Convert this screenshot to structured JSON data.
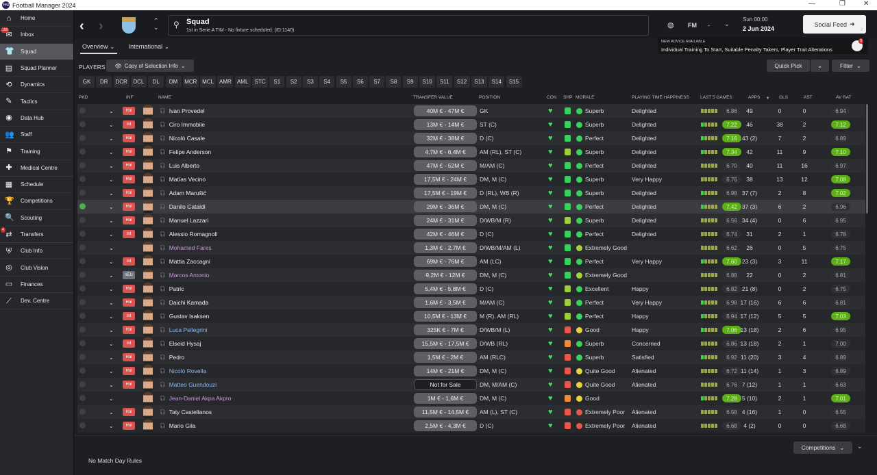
{
  "window": {
    "title": "Football Manager 2024",
    "logo": "24"
  },
  "sidebar": {
    "items": [
      {
        "label": "Home",
        "icon": "⌂"
      },
      {
        "label": "Inbox",
        "icon": "✉",
        "badge": "150"
      },
      {
        "label": "Squad",
        "icon": "👕",
        "active": true
      },
      {
        "label": "Squad Planner",
        "icon": "▤"
      },
      {
        "label": "Dynamics",
        "icon": "⟲"
      },
      {
        "label": "Tactics",
        "icon": "✎"
      },
      {
        "label": "Data Hub",
        "icon": "◉"
      },
      {
        "label": "Staff",
        "icon": "👥"
      },
      {
        "label": "Training",
        "icon": "⚑"
      },
      {
        "label": "Medical Centre",
        "icon": "✚"
      },
      {
        "label": "Schedule",
        "icon": "▦"
      },
      {
        "label": "Competitions",
        "icon": "🏆"
      },
      {
        "label": "Scouting",
        "icon": "🔍"
      },
      {
        "label": "Transfers",
        "icon": "⇄",
        "badge": "4"
      },
      {
        "label": "Club Info",
        "icon": "⛨"
      },
      {
        "label": "Club Vision",
        "icon": "◎"
      },
      {
        "label": "Finances",
        "icon": "▭"
      },
      {
        "label": "Dev. Centre",
        "icon": "⟋"
      }
    ]
  },
  "header": {
    "title": "Squad",
    "subtitle": "1st in Serie A TIM - No fixture scheduled. (ID:1140)",
    "fm": "FM",
    "dash": "-",
    "time": "Sun 00:00",
    "date": "2 Jun 2024",
    "social": "Social Feed",
    "social_count": "2",
    "advice_title": "NEW ADVICE AVAILABLE",
    "advice": "Individual Training To Start, Suitable Penalty Takers, Player Trait Alterations",
    "advice_badge": "3"
  },
  "tabs": [
    {
      "label": "Overview ⌄"
    },
    {
      "label": "International ⌄"
    }
  ],
  "players_label": "PLAYERS",
  "view_select": "Copy of Selection Info",
  "quick_pick": "Quick Pick",
  "filter": "Filter",
  "positions": [
    "GK",
    "DR",
    "DCR",
    "DCL",
    "DL",
    "DM",
    "MCR",
    "MCL",
    "AMR",
    "AML",
    "STC",
    "S1",
    "S2",
    "S3",
    "S4",
    "S5",
    "S6",
    "S7",
    "S8",
    "S9",
    "S10",
    "S11",
    "S12",
    "S13",
    "S14",
    "S15"
  ],
  "columns": {
    "pkd": "PKD",
    "inf": "INF",
    "name": "NAME",
    "tv": "TRANSFER VALUE",
    "pos": "POSITION",
    "con": "CON",
    "shp": "SHP",
    "morale": "MORALE",
    "pth": "PLAYING TIME HAPPINESS",
    "l5": "LAST 5 GAMES",
    "apps": "APPS",
    "gls": "GLS",
    "ast": "AST",
    "avr": "AV RAT"
  },
  "colors": {
    "accent_green": "#5cae1a",
    "badge_red": "#d9534f"
  },
  "players": [
    {
      "pkd": false,
      "inf": "Hol",
      "name": "Ivan Provedel",
      "nc": "",
      "tv": "40M € - 47M €",
      "pos": "GK",
      "shp": "good",
      "mor": "Superb",
      "pth": "Delighted",
      "l5": "6.86",
      "apps": "49",
      "gls": "0",
      "ast": "0",
      "avr": "6.94"
    },
    {
      "pkd": false,
      "inf": "Int",
      "name": "Ciro Immobile",
      "nc": "",
      "tv": "13M € - 14M €",
      "pos": "ST (C)",
      "shp": "good",
      "mor": "Superb",
      "pth": "Delighted",
      "l5": "7.22",
      "apps": "46",
      "gls": "38",
      "ast": "2",
      "avr": "7.12"
    },
    {
      "pkd": false,
      "inf": "Hol",
      "name": "Nicolò Casale",
      "nc": "",
      "tv": "32M € - 38M €",
      "pos": "D (C)",
      "shp": "good",
      "mor": "Perfect",
      "pth": "Delighted",
      "l5": "7.16",
      "apps": "43 (2)",
      "gls": "7",
      "ast": "2",
      "avr": "6.89"
    },
    {
      "pkd": false,
      "inf": "Hol",
      "name": "Felipe Anderson",
      "nc": "",
      "tv": "4,7M € - 6,4M €",
      "pos": "AM (RL), ST (C)",
      "shp": "ok",
      "mor": "Superb",
      "pth": "Delighted",
      "l5": "7.34",
      "apps": "42",
      "gls": "11",
      "ast": "9",
      "avr": "7.10"
    },
    {
      "pkd": false,
      "inf": "Hol",
      "name": "Luis Alberto",
      "nc": "",
      "tv": "47M € - 52M €",
      "pos": "M/AM (C)",
      "shp": "good",
      "mor": "Perfect",
      "pth": "Delighted",
      "l5": "6.70",
      "apps": "40",
      "gls": "11",
      "ast": "16",
      "avr": "6.97"
    },
    {
      "pkd": false,
      "inf": "Hol",
      "name": "Matías Vecino",
      "nc": "",
      "tv": "17,5M € - 24M €",
      "pos": "DM, M (C)",
      "shp": "good",
      "mor": "Superb",
      "pth": "Very Happy",
      "l5": "6.76",
      "apps": "38",
      "gls": "13",
      "ast": "12",
      "avr": "7.08"
    },
    {
      "pkd": false,
      "inf": "Hol",
      "name": "Adam Marušić",
      "nc": "",
      "tv": "17,5M € - 19M €",
      "pos": "D (RL), WB (R)",
      "shp": "good",
      "mor": "Superb",
      "pth": "Delighted",
      "l5": "6.98",
      "apps": "37 (7)",
      "gls": "2",
      "ast": "8",
      "avr": "7.02"
    },
    {
      "pkd": true,
      "inf": "Hol",
      "name": "Danilo Cataldi",
      "nc": "",
      "tv": "29M € - 36M €",
      "pos": "DM, M (C)",
      "shp": "good",
      "mor": "Perfect",
      "pth": "Delighted",
      "l5": "7.42",
      "apps": "37 (3)",
      "gls": "6",
      "ast": "2",
      "avr": "6.96"
    },
    {
      "pkd": false,
      "inf": "Hol",
      "name": "Manuel Lazzari",
      "nc": "",
      "tv": "24M € - 31M €",
      "pos": "D/WB/M (R)",
      "shp": "ok",
      "mor": "Superb",
      "pth": "Delighted",
      "l5": "6.56",
      "apps": "34 (4)",
      "gls": "0",
      "ast": "6",
      "avr": "6.95"
    },
    {
      "pkd": false,
      "inf": "Int",
      "name": "Alessio Romagnoli",
      "nc": "",
      "tv": "42M € - 46M €",
      "pos": "D (C)",
      "shp": "good",
      "mor": "Perfect",
      "pth": "Delighted",
      "l5": "6.74",
      "apps": "31",
      "gls": "2",
      "ast": "1",
      "avr": "6.78"
    },
    {
      "pkd": false,
      "inf": "",
      "name": "Mohamed Fares",
      "nc": "purple",
      "tv": "1,3M € - 2,7M €",
      "pos": "D/WB/M/AM (L)",
      "shp": "good",
      "mor": "Extremely Good",
      "pth": "",
      "l5": "6.62",
      "apps": "26",
      "gls": "0",
      "ast": "5",
      "avr": "6.75"
    },
    {
      "pkd": false,
      "inf": "Int",
      "name": "Mattia Zaccagni",
      "nc": "",
      "tv": "69M € - 76M €",
      "pos": "AM (LC)",
      "shp": "good",
      "mor": "Perfect",
      "pth": "Very Happy",
      "l5": "7.60",
      "apps": "23 (3)",
      "gls": "3",
      "ast": "11",
      "avr": "7.17"
    },
    {
      "pkd": false,
      "inf": "nEU",
      "name": "Marcos Antonio",
      "nc": "purple",
      "tv": "9,2M € - 12M €",
      "pos": "DM, M (C)",
      "shp": "good",
      "mor": "Extremely Good",
      "pth": "",
      "l5": "6.88",
      "apps": "22",
      "gls": "0",
      "ast": "2",
      "avr": "6.81"
    },
    {
      "pkd": false,
      "inf": "Hol",
      "name": "Patric",
      "nc": "",
      "tv": "5,4M € - 5,8M €",
      "pos": "D (C)",
      "shp": "ok",
      "mor": "Excellent",
      "pth": "Happy",
      "l5": "6.82",
      "apps": "21 (8)",
      "gls": "0",
      "ast": "2",
      "avr": "6.75"
    },
    {
      "pkd": false,
      "inf": "Hol",
      "name": "Daichi Kamada",
      "nc": "",
      "tv": "1,6M € - 3,5M €",
      "pos": "M/AM (C)",
      "shp": "ok",
      "mor": "Perfect",
      "pth": "Very Happy",
      "l5": "6.98",
      "apps": "17 (16)",
      "gls": "6",
      "ast": "6",
      "avr": "6.81"
    },
    {
      "pkd": false,
      "inf": "Int",
      "name": "Gustav Isaksen",
      "nc": "",
      "tv": "10,5M € - 13M €",
      "pos": "M (R), AM (RL)",
      "shp": "ok",
      "mor": "Perfect",
      "pth": "Happy",
      "l5": "6.94",
      "apps": "17 (12)",
      "gls": "5",
      "ast": "5",
      "avr": "7.03"
    },
    {
      "pkd": false,
      "inf": "Hol",
      "name": "Luca Pellegrini",
      "nc": "blue",
      "tv": "325K € - 7M €",
      "pos": "D/WB/M (L)",
      "shp": "bad",
      "mor": "Good",
      "pth": "Happy",
      "l5": "7.06",
      "apps": "13 (18)",
      "gls": "2",
      "ast": "6",
      "avr": "6.95"
    },
    {
      "pkd": false,
      "inf": "Int",
      "name": "Elseid Hysaj",
      "nc": "",
      "tv": "15,5M € - 17,5M €",
      "pos": "D/WB (RL)",
      "shp": "warn",
      "mor": "Superb",
      "pth": "Concerned",
      "l5": "6.86",
      "apps": "13 (18)",
      "gls": "2",
      "ast": "1",
      "avr": "7.00"
    },
    {
      "pkd": false,
      "inf": "Hol",
      "name": "Pedro",
      "nc": "",
      "tv": "1,5M € - 2M €",
      "pos": "AM (RLC)",
      "shp": "bad",
      "mor": "Superb",
      "pth": "Satisfied",
      "l5": "6.92",
      "apps": "11 (20)",
      "gls": "3",
      "ast": "4",
      "avr": "6.89"
    },
    {
      "pkd": false,
      "inf": "Hol",
      "name": "Nicolò Rovella",
      "nc": "blue",
      "tv": "14M € - 21M €",
      "pos": "DM, M (C)",
      "shp": "bad",
      "mor": "Quite Good",
      "pth": "Alienated",
      "l5": "6.72",
      "apps": "11 (14)",
      "gls": "1",
      "ast": "3",
      "avr": "6.89"
    },
    {
      "pkd": false,
      "inf": "Hol",
      "name": "Matteo Guendouzi",
      "nc": "blue",
      "tv": "Not for Sale",
      "pos": "DM, M/AM (C)",
      "shp": "bad",
      "mor": "Quite Good",
      "pth": "Alienated",
      "l5": "6.76",
      "apps": "7 (12)",
      "gls": "1",
      "ast": "1",
      "avr": "6.63"
    },
    {
      "pkd": false,
      "inf": "",
      "name": "Jean-Daniel Akpa Akpro",
      "nc": "purple",
      "tv": "1M € - 1,6M €",
      "pos": "DM, M (C)",
      "shp": "warn",
      "mor": "Good",
      "pth": "",
      "l5": "7.28",
      "apps": "5 (10)",
      "gls": "2",
      "ast": "1",
      "avr": "7.01"
    },
    {
      "pkd": false,
      "inf": "Hol",
      "name": "Taty Castellanos",
      "nc": "",
      "tv": "11,5M € - 14,5M €",
      "pos": "AM (L), ST (C)",
      "shp": "bad",
      "mor": "Extremely Poor",
      "pth": "Alienated",
      "l5": "6.58",
      "apps": "4 (16)",
      "gls": "1",
      "ast": "0",
      "avr": "6.55"
    },
    {
      "pkd": false,
      "inf": "Hol",
      "name": "Mario Gila",
      "nc": "",
      "tv": "2,5M € - 4,3M €",
      "pos": "D (C)",
      "shp": "bad",
      "mor": "Extremely Poor",
      "pth": "Alienated",
      "l5": "6.68",
      "apps": "4 (2)",
      "gls": "0",
      "ast": "0",
      "avr": "6.68"
    }
  ],
  "footer": {
    "rules": "No Match Day Rules",
    "competitions": "Competitions"
  }
}
